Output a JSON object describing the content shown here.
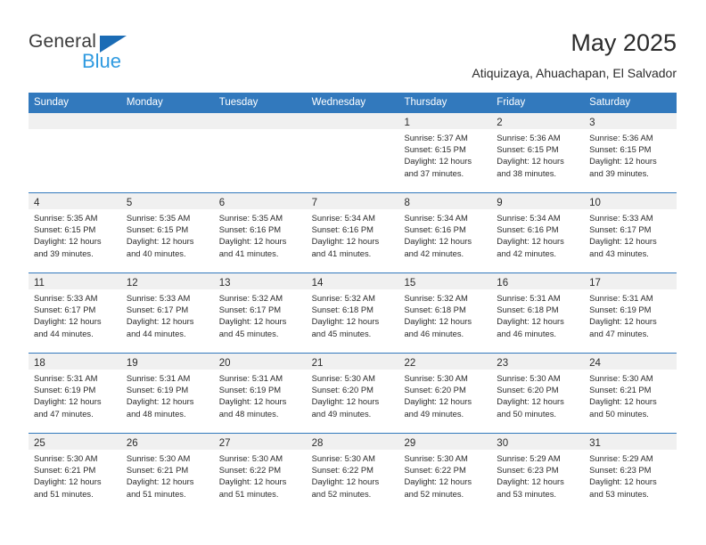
{
  "brand": {
    "name_part1": "General",
    "name_part2": "Blue",
    "triangle_color": "#1b6cb5",
    "blue_color": "#2f9ae0"
  },
  "header": {
    "month_title": "May 2025",
    "location": "Atiquizaya, Ahuachapan, El Salvador",
    "header_bg": "#3279bd"
  },
  "weekdays": [
    "Sunday",
    "Monday",
    "Tuesday",
    "Wednesday",
    "Thursday",
    "Friday",
    "Saturday"
  ],
  "weeks": [
    [
      {
        "day": "",
        "sunrise": "",
        "sunset": "",
        "daylight1": "",
        "daylight2": "",
        "empty": true
      },
      {
        "day": "",
        "sunrise": "",
        "sunset": "",
        "daylight1": "",
        "daylight2": "",
        "empty": true
      },
      {
        "day": "",
        "sunrise": "",
        "sunset": "",
        "daylight1": "",
        "daylight2": "",
        "empty": true
      },
      {
        "day": "",
        "sunrise": "",
        "sunset": "",
        "daylight1": "",
        "daylight2": "",
        "empty": true
      },
      {
        "day": "1",
        "sunrise": "Sunrise: 5:37 AM",
        "sunset": "Sunset: 6:15 PM",
        "daylight1": "Daylight: 12 hours",
        "daylight2": "and 37 minutes.",
        "empty": false
      },
      {
        "day": "2",
        "sunrise": "Sunrise: 5:36 AM",
        "sunset": "Sunset: 6:15 PM",
        "daylight1": "Daylight: 12 hours",
        "daylight2": "and 38 minutes.",
        "empty": false
      },
      {
        "day": "3",
        "sunrise": "Sunrise: 5:36 AM",
        "sunset": "Sunset: 6:15 PM",
        "daylight1": "Daylight: 12 hours",
        "daylight2": "and 39 minutes.",
        "empty": false
      }
    ],
    [
      {
        "day": "4",
        "sunrise": "Sunrise: 5:35 AM",
        "sunset": "Sunset: 6:15 PM",
        "daylight1": "Daylight: 12 hours",
        "daylight2": "and 39 minutes.",
        "empty": false
      },
      {
        "day": "5",
        "sunrise": "Sunrise: 5:35 AM",
        "sunset": "Sunset: 6:15 PM",
        "daylight1": "Daylight: 12 hours",
        "daylight2": "and 40 minutes.",
        "empty": false
      },
      {
        "day": "6",
        "sunrise": "Sunrise: 5:35 AM",
        "sunset": "Sunset: 6:16 PM",
        "daylight1": "Daylight: 12 hours",
        "daylight2": "and 41 minutes.",
        "empty": false
      },
      {
        "day": "7",
        "sunrise": "Sunrise: 5:34 AM",
        "sunset": "Sunset: 6:16 PM",
        "daylight1": "Daylight: 12 hours",
        "daylight2": "and 41 minutes.",
        "empty": false
      },
      {
        "day": "8",
        "sunrise": "Sunrise: 5:34 AM",
        "sunset": "Sunset: 6:16 PM",
        "daylight1": "Daylight: 12 hours",
        "daylight2": "and 42 minutes.",
        "empty": false
      },
      {
        "day": "9",
        "sunrise": "Sunrise: 5:34 AM",
        "sunset": "Sunset: 6:16 PM",
        "daylight1": "Daylight: 12 hours",
        "daylight2": "and 42 minutes.",
        "empty": false
      },
      {
        "day": "10",
        "sunrise": "Sunrise: 5:33 AM",
        "sunset": "Sunset: 6:17 PM",
        "daylight1": "Daylight: 12 hours",
        "daylight2": "and 43 minutes.",
        "empty": false
      }
    ],
    [
      {
        "day": "11",
        "sunrise": "Sunrise: 5:33 AM",
        "sunset": "Sunset: 6:17 PM",
        "daylight1": "Daylight: 12 hours",
        "daylight2": "and 44 minutes.",
        "empty": false
      },
      {
        "day": "12",
        "sunrise": "Sunrise: 5:33 AM",
        "sunset": "Sunset: 6:17 PM",
        "daylight1": "Daylight: 12 hours",
        "daylight2": "and 44 minutes.",
        "empty": false
      },
      {
        "day": "13",
        "sunrise": "Sunrise: 5:32 AM",
        "sunset": "Sunset: 6:17 PM",
        "daylight1": "Daylight: 12 hours",
        "daylight2": "and 45 minutes.",
        "empty": false
      },
      {
        "day": "14",
        "sunrise": "Sunrise: 5:32 AM",
        "sunset": "Sunset: 6:18 PM",
        "daylight1": "Daylight: 12 hours",
        "daylight2": "and 45 minutes.",
        "empty": false
      },
      {
        "day": "15",
        "sunrise": "Sunrise: 5:32 AM",
        "sunset": "Sunset: 6:18 PM",
        "daylight1": "Daylight: 12 hours",
        "daylight2": "and 46 minutes.",
        "empty": false
      },
      {
        "day": "16",
        "sunrise": "Sunrise: 5:31 AM",
        "sunset": "Sunset: 6:18 PM",
        "daylight1": "Daylight: 12 hours",
        "daylight2": "and 46 minutes.",
        "empty": false
      },
      {
        "day": "17",
        "sunrise": "Sunrise: 5:31 AM",
        "sunset": "Sunset: 6:19 PM",
        "daylight1": "Daylight: 12 hours",
        "daylight2": "and 47 minutes.",
        "empty": false
      }
    ],
    [
      {
        "day": "18",
        "sunrise": "Sunrise: 5:31 AM",
        "sunset": "Sunset: 6:19 PM",
        "daylight1": "Daylight: 12 hours",
        "daylight2": "and 47 minutes.",
        "empty": false
      },
      {
        "day": "19",
        "sunrise": "Sunrise: 5:31 AM",
        "sunset": "Sunset: 6:19 PM",
        "daylight1": "Daylight: 12 hours",
        "daylight2": "and 48 minutes.",
        "empty": false
      },
      {
        "day": "20",
        "sunrise": "Sunrise: 5:31 AM",
        "sunset": "Sunset: 6:19 PM",
        "daylight1": "Daylight: 12 hours",
        "daylight2": "and 48 minutes.",
        "empty": false
      },
      {
        "day": "21",
        "sunrise": "Sunrise: 5:30 AM",
        "sunset": "Sunset: 6:20 PM",
        "daylight1": "Daylight: 12 hours",
        "daylight2": "and 49 minutes.",
        "empty": false
      },
      {
        "day": "22",
        "sunrise": "Sunrise: 5:30 AM",
        "sunset": "Sunset: 6:20 PM",
        "daylight1": "Daylight: 12 hours",
        "daylight2": "and 49 minutes.",
        "empty": false
      },
      {
        "day": "23",
        "sunrise": "Sunrise: 5:30 AM",
        "sunset": "Sunset: 6:20 PM",
        "daylight1": "Daylight: 12 hours",
        "daylight2": "and 50 minutes.",
        "empty": false
      },
      {
        "day": "24",
        "sunrise": "Sunrise: 5:30 AM",
        "sunset": "Sunset: 6:21 PM",
        "daylight1": "Daylight: 12 hours",
        "daylight2": "and 50 minutes.",
        "empty": false
      }
    ],
    [
      {
        "day": "25",
        "sunrise": "Sunrise: 5:30 AM",
        "sunset": "Sunset: 6:21 PM",
        "daylight1": "Daylight: 12 hours",
        "daylight2": "and 51 minutes.",
        "empty": false
      },
      {
        "day": "26",
        "sunrise": "Sunrise: 5:30 AM",
        "sunset": "Sunset: 6:21 PM",
        "daylight1": "Daylight: 12 hours",
        "daylight2": "and 51 minutes.",
        "empty": false
      },
      {
        "day": "27",
        "sunrise": "Sunrise: 5:30 AM",
        "sunset": "Sunset: 6:22 PM",
        "daylight1": "Daylight: 12 hours",
        "daylight2": "and 51 minutes.",
        "empty": false
      },
      {
        "day": "28",
        "sunrise": "Sunrise: 5:30 AM",
        "sunset": "Sunset: 6:22 PM",
        "daylight1": "Daylight: 12 hours",
        "daylight2": "and 52 minutes.",
        "empty": false
      },
      {
        "day": "29",
        "sunrise": "Sunrise: 5:30 AM",
        "sunset": "Sunset: 6:22 PM",
        "daylight1": "Daylight: 12 hours",
        "daylight2": "and 52 minutes.",
        "empty": false
      },
      {
        "day": "30",
        "sunrise": "Sunrise: 5:29 AM",
        "sunset": "Sunset: 6:23 PM",
        "daylight1": "Daylight: 12 hours",
        "daylight2": "and 53 minutes.",
        "empty": false
      },
      {
        "day": "31",
        "sunrise": "Sunrise: 5:29 AM",
        "sunset": "Sunset: 6:23 PM",
        "daylight1": "Daylight: 12 hours",
        "daylight2": "and 53 minutes.",
        "empty": false
      }
    ]
  ]
}
